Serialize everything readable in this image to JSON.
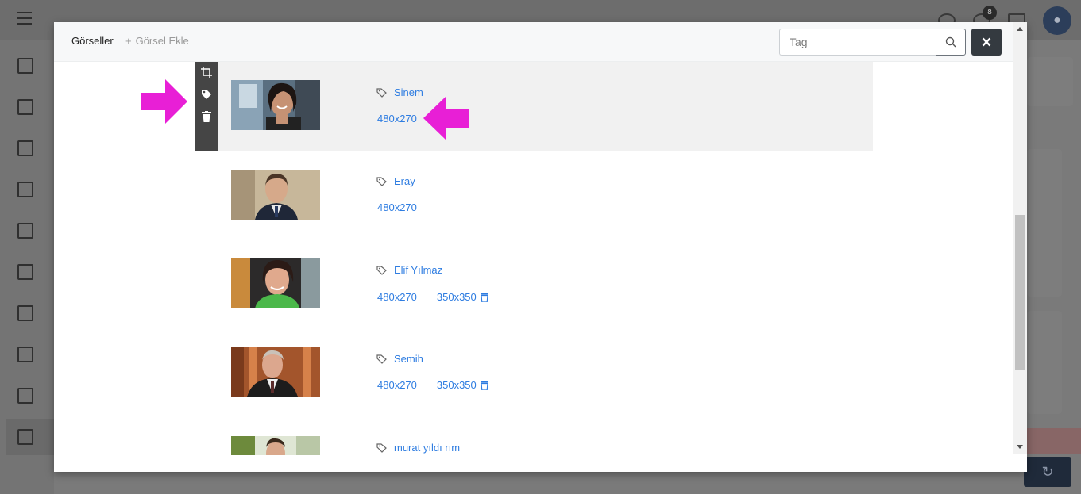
{
  "modal": {
    "tabs": {
      "active_label": "Görseller",
      "add_label": "Görsel Ekle",
      "add_prefix": "+"
    },
    "search": {
      "placeholder": "Tag",
      "value": ""
    },
    "close_icon": "close-icon"
  },
  "images": [
    {
      "tag": "Sinem",
      "sizes": [
        "480x270"
      ],
      "highlighted": true,
      "size_trash": false
    },
    {
      "tag": "Eray",
      "sizes": [
        "480x270"
      ],
      "highlighted": false,
      "size_trash": false
    },
    {
      "tag": "Elif Yılmaz",
      "sizes": [
        "480x270",
        "350x350"
      ],
      "highlighted": false,
      "size_trash": true
    },
    {
      "tag": "Semih",
      "sizes": [
        "480x270",
        "350x350"
      ],
      "highlighted": false,
      "size_trash": true
    },
    {
      "tag": "murat yıldı rım",
      "sizes": [],
      "highlighted": false,
      "size_trash": false
    }
  ],
  "row_toolbar": {
    "icons": [
      "crop-icon",
      "tag-icon",
      "trash-icon"
    ]
  },
  "background": {
    "notification_count": "8",
    "colors": {
      "accent_link": "#2f7de1",
      "annotation_arrow": "#e81fd6",
      "toolbar": "#454545"
    }
  }
}
